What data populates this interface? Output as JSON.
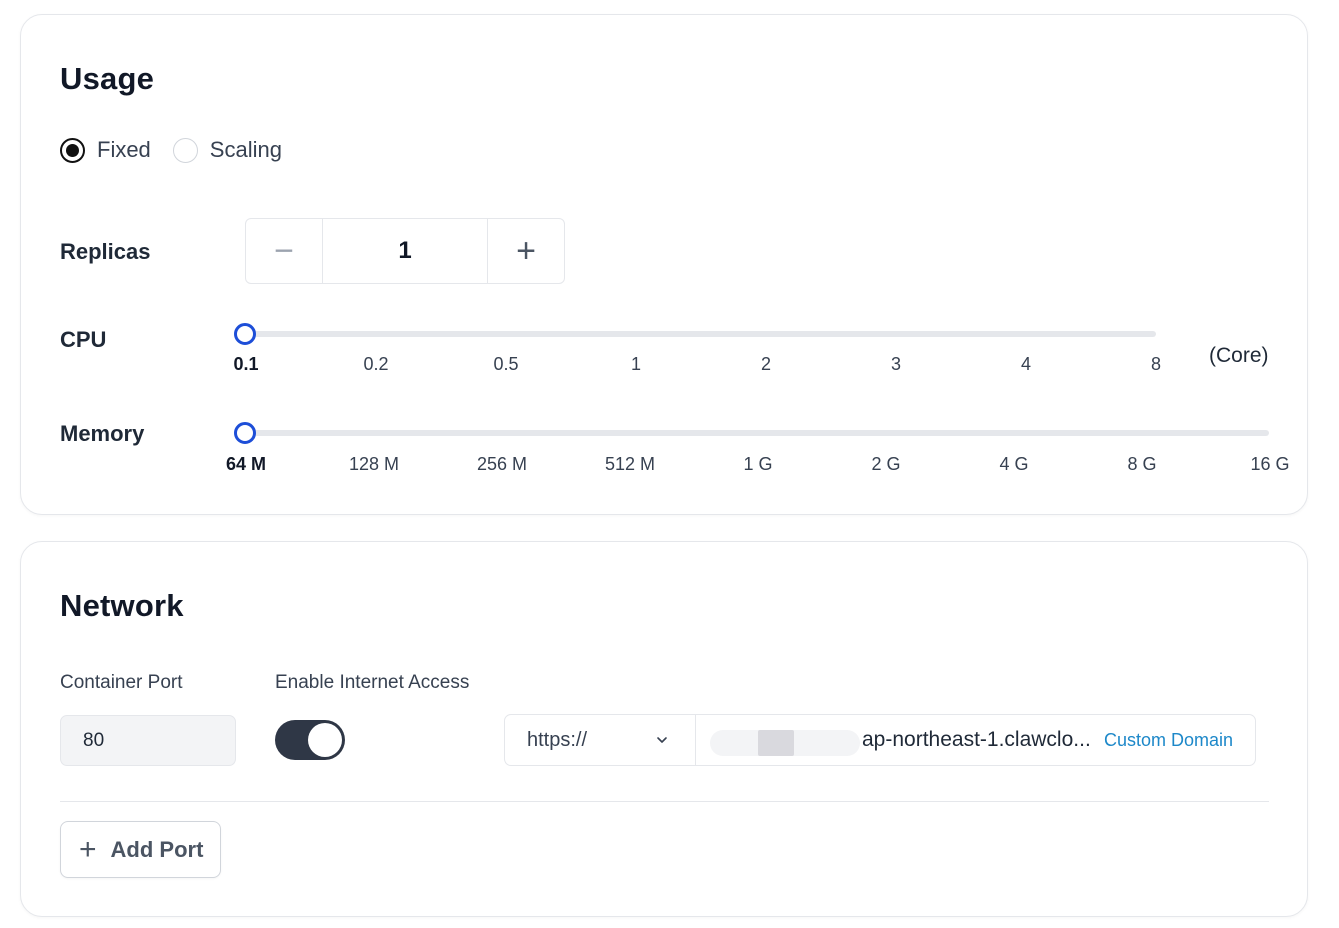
{
  "usage": {
    "title": "Usage",
    "modes": [
      {
        "label": "Fixed",
        "checked": true
      },
      {
        "label": "Scaling",
        "checked": false
      }
    ],
    "replicas": {
      "label": "Replicas",
      "value": "1",
      "minus": "−",
      "plus": "+"
    },
    "cpu": {
      "label": "CPU",
      "unit": "(Core)",
      "ticks": [
        "0.1",
        "0.2",
        "0.5",
        "1",
        "2",
        "3",
        "4",
        "8"
      ],
      "selected_index": 0
    },
    "memory": {
      "label": "Memory",
      "ticks": [
        "64 M",
        "128 M",
        "256 M",
        "512 M",
        "1 G",
        "2 G",
        "4 G",
        "8 G",
        "16 G"
      ],
      "selected_index": 0
    }
  },
  "network": {
    "title": "Network",
    "container_port_label": "Container Port",
    "container_port_value": "80",
    "internet_label": "Enable Internet Access",
    "internet_enabled": true,
    "protocol": "https://",
    "domain": "ap-northeast-1.clawclo...",
    "custom_domain_label": "Custom Domain",
    "add_port_label": "Add Port",
    "add_port_icon": "plus-icon"
  },
  "colors": {
    "accent": "#1d4ed8",
    "link": "#1d88c9",
    "toggle_on": "#2f3746"
  }
}
